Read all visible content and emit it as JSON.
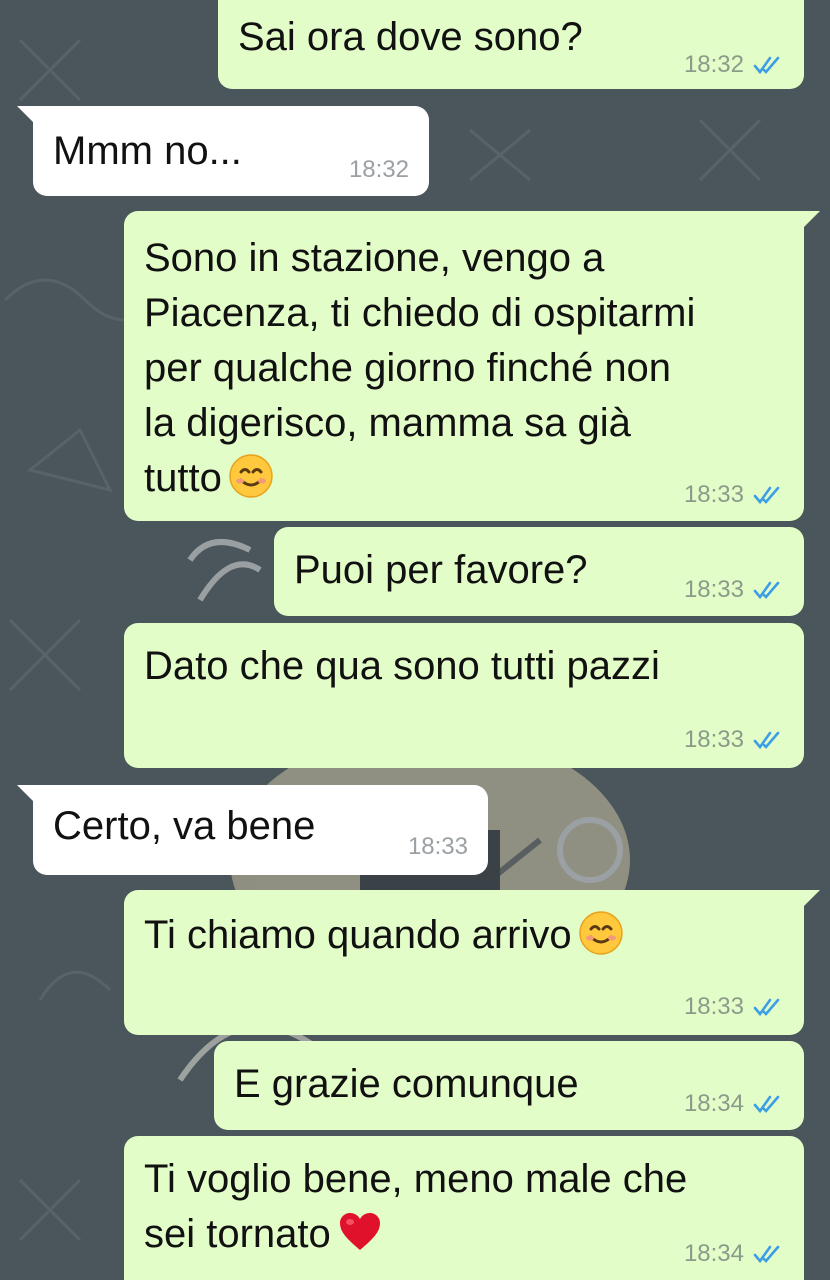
{
  "messages": [
    {
      "direction": "out",
      "text": "Sai ora dove sono?",
      "time": "18:32",
      "status": "read"
    },
    {
      "direction": "in",
      "text": "Mmm no...",
      "time": "18:32"
    },
    {
      "direction": "out",
      "text": "Sono in stazione, vengo a\nPiacenza, ti chiedo di ospitarmi\nper qualche giorno finché non\nla digerisco, mamma sa già\ntutto",
      "emoji": "smiling-face-emoji",
      "time": "18:33",
      "status": "read"
    },
    {
      "direction": "out",
      "text": "Puoi per favore?",
      "time": "18:33",
      "status": "read"
    },
    {
      "direction": "out",
      "text": "Dato che qua sono tutti pazzi",
      "time": "18:33",
      "status": "read"
    },
    {
      "direction": "in",
      "text": "Certo, va bene",
      "time": "18:33"
    },
    {
      "direction": "out",
      "text": "Ti chiamo quando arrivo",
      "emoji": "smiling-face-emoji",
      "time": "18:33",
      "status": "read"
    },
    {
      "direction": "out",
      "text": "E grazie comunque",
      "time": "18:34",
      "status": "read"
    },
    {
      "direction": "out",
      "text": "Ti voglio bene, meno male che\nsei tornato",
      "emoji": "red-heart-emoji",
      "time": "18:34",
      "status": "read"
    }
  ],
  "colors": {
    "wallpaper": "#4a565c",
    "outgoing_bubble": "#e2fdc8",
    "incoming_bubble": "#ffffff",
    "read_ticks": "#3b9ee6"
  }
}
